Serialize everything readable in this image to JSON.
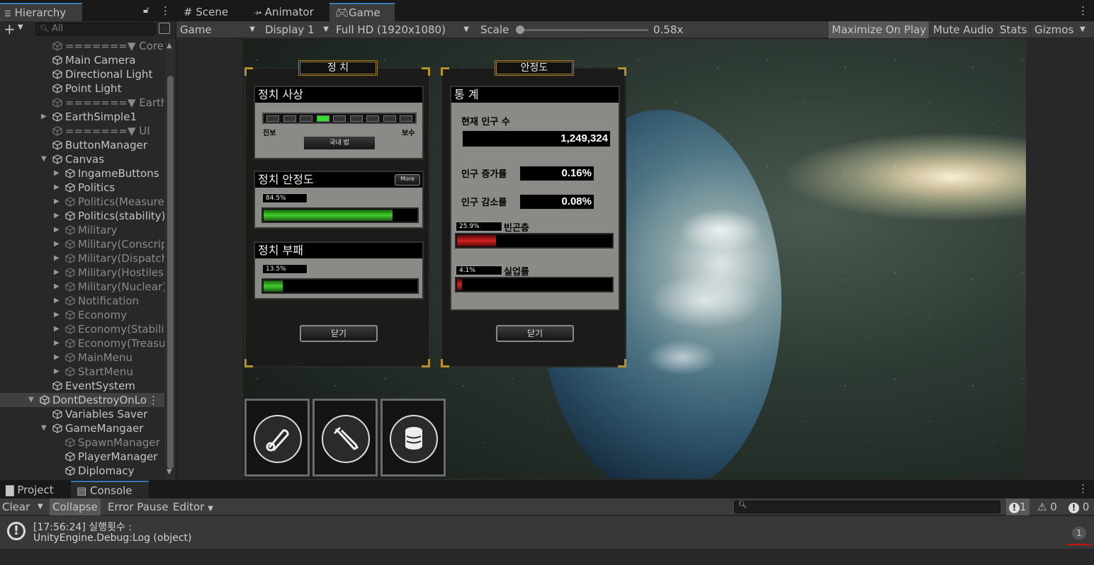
{
  "hierarchy": {
    "tab": "Hierarchy",
    "search_placeholder": "All",
    "add": "+",
    "items": [
      {
        "label": "=======▼ Core",
        "indent": 1,
        "dim": true,
        "arrow": ""
      },
      {
        "label": "Main Camera",
        "indent": 1,
        "dim": false,
        "arrow": ""
      },
      {
        "label": "Directional Light",
        "indent": 1,
        "dim": false,
        "arrow": ""
      },
      {
        "label": "Point Light",
        "indent": 1,
        "dim": false,
        "arrow": ""
      },
      {
        "label": "=======▼ Earth",
        "indent": 1,
        "dim": true,
        "arrow": ""
      },
      {
        "label": "EarthSimple1",
        "indent": 1,
        "dim": false,
        "arrow": "▶"
      },
      {
        "label": "=======▼ UI",
        "indent": 1,
        "dim": true,
        "arrow": ""
      },
      {
        "label": "ButtonManager",
        "indent": 1,
        "dim": false,
        "arrow": ""
      },
      {
        "label": "Canvas",
        "indent": 1,
        "dim": false,
        "arrow": "▼"
      },
      {
        "label": "IngameButtons",
        "indent": 2,
        "dim": false,
        "arrow": "▶"
      },
      {
        "label": "Politics",
        "indent": 2,
        "dim": false,
        "arrow": "▶"
      },
      {
        "label": "Politics(Measure",
        "indent": 2,
        "dim": true,
        "arrow": "▶"
      },
      {
        "label": "Politics(stability)",
        "indent": 2,
        "dim": false,
        "arrow": "▶"
      },
      {
        "label": "Military",
        "indent": 2,
        "dim": true,
        "arrow": "▶"
      },
      {
        "label": "Military(Conscrip",
        "indent": 2,
        "dim": true,
        "arrow": "▶"
      },
      {
        "label": "Military(Dispatch",
        "indent": 2,
        "dim": true,
        "arrow": "▶"
      },
      {
        "label": "Military(Hostiles",
        "indent": 2,
        "dim": true,
        "arrow": "▶"
      },
      {
        "label": "Military(Nuclear)",
        "indent": 2,
        "dim": true,
        "arrow": "▶"
      },
      {
        "label": "Notification",
        "indent": 2,
        "dim": true,
        "arrow": "▶"
      },
      {
        "label": "Economy",
        "indent": 2,
        "dim": true,
        "arrow": "▶"
      },
      {
        "label": "Economy(Stabili",
        "indent": 2,
        "dim": true,
        "arrow": "▶"
      },
      {
        "label": "Economy(Treasu",
        "indent": 2,
        "dim": true,
        "arrow": "▶"
      },
      {
        "label": "MainMenu",
        "indent": 2,
        "dim": true,
        "arrow": "▶"
      },
      {
        "label": "StartMenu",
        "indent": 2,
        "dim": true,
        "arrow": "▶"
      },
      {
        "label": "EventSystem",
        "indent": 1,
        "dim": false,
        "arrow": ""
      },
      {
        "label": "DontDestroyOnLo",
        "indent": 0,
        "dim": false,
        "arrow": "▼",
        "selected": true,
        "scene": true
      },
      {
        "label": "Variables Saver",
        "indent": 1,
        "dim": false,
        "arrow": ""
      },
      {
        "label": "GameMangaer",
        "indent": 1,
        "dim": false,
        "arrow": "▼"
      },
      {
        "label": "SpawnManager",
        "indent": 2,
        "dim": true,
        "arrow": ""
      },
      {
        "label": "PlayerManager",
        "indent": 2,
        "dim": false,
        "arrow": ""
      },
      {
        "label": "Diplomacy",
        "indent": 2,
        "dim": false,
        "arrow": ""
      }
    ]
  },
  "tabs": {
    "scene": "Scene",
    "animator": "Animator",
    "game": "Game"
  },
  "gametoolbar": {
    "game": "Game",
    "display": "Display 1",
    "resolution": "Full HD (1920x1080)",
    "scale_label": "Scale",
    "scale_value": "0.58x",
    "maximize": "Maximize On Play",
    "mute": "Mute Audio",
    "stats": "Stats",
    "gizmos": "Gizmos"
  },
  "game": {
    "politics": {
      "title": "정 치",
      "ideology_header": "정치 사상",
      "left_label": "진보",
      "right_label": "보수",
      "law_button": "국내 법",
      "stability_header": "정치 안정도",
      "more": "More",
      "stability_pct": "84.5%",
      "stability_value": 0.845,
      "corruption_header": "정치 부패",
      "corruption_pct": "13.5%",
      "corruption_value": 0.135,
      "close": "닫기"
    },
    "stats": {
      "title": "안정도",
      "header": "통 계",
      "population_label": "현재 인구 수",
      "population": "1,249,324",
      "growth_label": "인구 증가률",
      "growth": "0.16%",
      "decline_label": "인구 감소률",
      "decline": "0.08%",
      "poverty_pct": "25.9%",
      "poverty_label": "빈곤층",
      "poverty_value": 0.259,
      "unemployment_pct": "4.1%",
      "unemployment_label": "실업률",
      "unemployment_value": 0.041,
      "close": "닫기"
    }
  },
  "console": {
    "project_tab": "Project",
    "console_tab": "Console",
    "clear": "Clear",
    "collapse": "Collapse",
    "error_pause": "Error Pause",
    "editor": "Editor",
    "count_info": "1",
    "count_warn": "0",
    "count_err": "0",
    "entry_line1": "[17:56:24] 실행횟수 :",
    "entry_line2": "UnityEngine.Debug:Log (object)",
    "entry_count": "1"
  }
}
